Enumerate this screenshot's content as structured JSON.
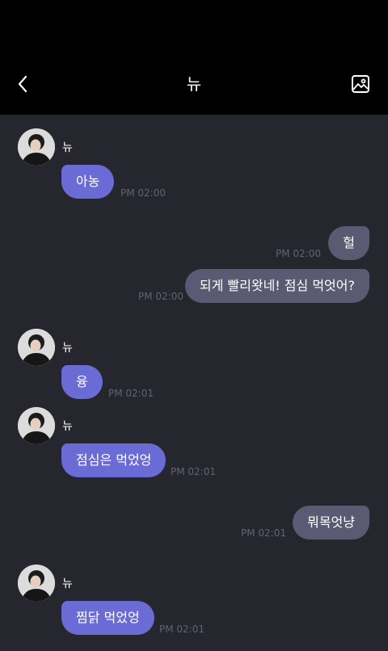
{
  "header": {
    "title": "뉴",
    "back_icon": "chevron-left-icon",
    "gallery_icon": "image-icon"
  },
  "colors": {
    "header_bg": "#000000",
    "chat_bg": "#26262e",
    "incoming_bubble": "#6b6bd6",
    "outgoing_bubble": "#5a5b72",
    "time_text": "#62636f"
  },
  "messages": [
    {
      "sender": "뉴",
      "text": "아농",
      "time": "PM 02:00"
    },
    {
      "text": "헐",
      "time": "PM 02:00"
    },
    {
      "text": "되게 빨리왓네! 점심 먹엇어?",
      "time": "PM 02:00"
    },
    {
      "sender": "뉴",
      "text": "융",
      "time": "PM 02:01"
    },
    {
      "sender": "뉴",
      "text": "점심은 먹었엉",
      "time": "PM 02:01"
    },
    {
      "text": "뭐목엇냥",
      "time": "PM 02:01"
    },
    {
      "sender": "뉴",
      "text": "찜닭 먹었엉",
      "time": "PM 02:01"
    }
  ]
}
